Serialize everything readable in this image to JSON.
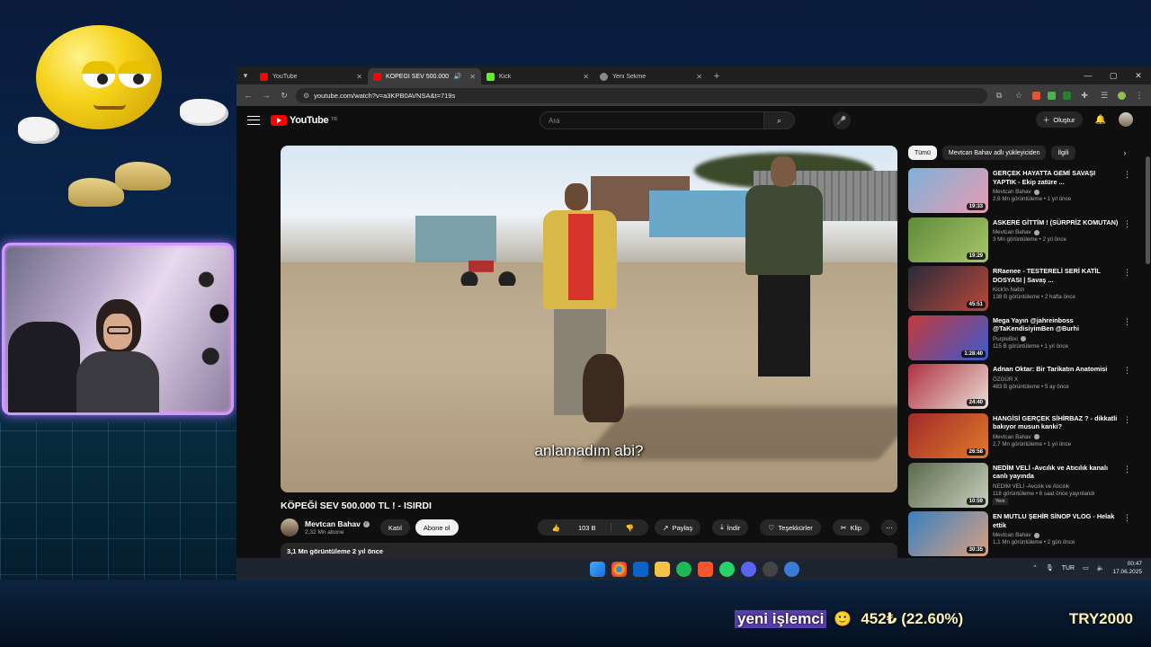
{
  "browser": {
    "tabs": [
      {
        "title": "YouTube",
        "favicon_color": "#ff0000",
        "active": false
      },
      {
        "title": "KÖPEĞİ SEV 500.000 TL ! -",
        "favicon_color": "#ff0000",
        "active": true
      },
      {
        "title": "Kick",
        "favicon_color": "#53fc18",
        "active": false
      },
      {
        "title": "Yeni Sekme",
        "favicon_color": "#888888",
        "active": false
      }
    ],
    "new_tab_icon": "plus-icon",
    "url": "youtube.com/watch?v=a3KPB0AVNSA&t=719s"
  },
  "youtube": {
    "logo_text": "YouTube",
    "logo_region": "TR",
    "search_placeholder": "Ara",
    "create_label": "Oluştur",
    "video": {
      "subtitle": "anlamadım abi?",
      "title": "KÖPEĞİ SEV 500.000 TL ! - ISIRDI",
      "channel": "Mevtcan Bahav",
      "subscribers": "2,32 Mn abone",
      "join_label": "Katıl",
      "subscribe_label": "Abone ol",
      "likes": "103 B",
      "share_label": "Paylaş",
      "download_label": "İndir",
      "thanks_label": "Teşekkürler",
      "clip_label": "Klip",
      "views_line": "3,1 Mn görüntüleme  2 yıl önce"
    },
    "chips": [
      "Tümü",
      "Mevtcan Bahav adlı yükleyiciden",
      "İlgili"
    ],
    "recommendations": [
      {
        "title": "GERÇEK HAYATTA GEMİ SAVAŞI YAPTIK - Ekip zatüre ...",
        "channel": "Mevtcan Bahav",
        "verified": true,
        "meta": "2,6 Mn görüntüleme • 1 yıl önce",
        "duration": "19:33",
        "thumb": [
          "#7fb0d8",
          "#e79bb2"
        ],
        "new": ""
      },
      {
        "title": "ASKERE GİTTİM ! (SÜRPRİZ KOMUTAN)",
        "channel": "Mevtcan Bahav",
        "verified": true,
        "meta": "3 Mn görüntüleme • 2 yıl önce",
        "duration": "19:29",
        "thumb": [
          "#5f8a3a",
          "#a9c56a"
        ],
        "new": ""
      },
      {
        "title": "RRaenee - TESTERELİ SERİ KATİL DOSYASI | Savaş ...",
        "channel": "Kick'in Nabzı",
        "verified": false,
        "meta": "138 B görüntüleme • 2 hafta önce",
        "duration": "45:51",
        "thumb": [
          "#2a2a3a",
          "#b8483a"
        ],
        "new": ""
      },
      {
        "title": "Mega Yayın @jahreinboss @TaKendisiyimBen @Burhi",
        "channel": "PurpleBixi",
        "verified": true,
        "meta": "115 B görüntüleme • 1 yıl önce",
        "duration": "1:28:40",
        "thumb": [
          "#c23a3a",
          "#3a5ad0"
        ],
        "new": ""
      },
      {
        "title": "Adnan Oktar: Bir Tarikatın Anatomisi",
        "channel": "ÖZGÜR X",
        "verified": false,
        "meta": "483 B görüntüleme • 5 ay önce",
        "duration": "24:40",
        "thumb": [
          "#b03040",
          "#e8e0d8"
        ],
        "new": ""
      },
      {
        "title": "HANGİSİ GERÇEK SİHİRBAZ ? - dikkatli bakıyor musun kanki?",
        "channel": "Mevtcan Bahav",
        "verified": true,
        "meta": "2,7 Mn görüntüleme • 1 yıl önce",
        "duration": "26:58",
        "thumb": [
          "#a02a2a",
          "#e07a2a"
        ],
        "new": ""
      },
      {
        "title": "NEDİM VELİ -Avcılık ve Atıcılık kanalı canlı yayında",
        "channel": "NEDİM VELİ -Avcılık ve Atıcılık",
        "verified": false,
        "meta": "118 görüntüleme • 6 saat önce yayınlandı",
        "duration": "10:59",
        "thumb": [
          "#5a6a4a",
          "#c8d0c0"
        ],
        "new": "Yeni"
      },
      {
        "title": "EN MUTLU ŞEHİR SİNOP VLOG - Helak ettik",
        "channel": "Mevtcan Bahav",
        "verified": true,
        "meta": "1,1 Mn görüntüleme • 2 gün önce",
        "duration": "30:35",
        "thumb": [
          "#3a80c0",
          "#d8a080"
        ],
        "new": ""
      }
    ]
  },
  "taskbar": {
    "apps": [
      "windows-start-icon",
      "chrome-icon",
      "outlook-icon",
      "file-explorer-icon",
      "spotify-icon",
      "brave-icon",
      "whatsapp-icon",
      "discord-icon",
      "game-icon",
      "extra-app-icon"
    ],
    "language": "TUR",
    "time": "00:47",
    "date": "17.06.2025"
  },
  "stream_ticker": {
    "label": "yeni işlemci",
    "price": "452₺ (22.60%)",
    "goal": "TRY2000"
  }
}
